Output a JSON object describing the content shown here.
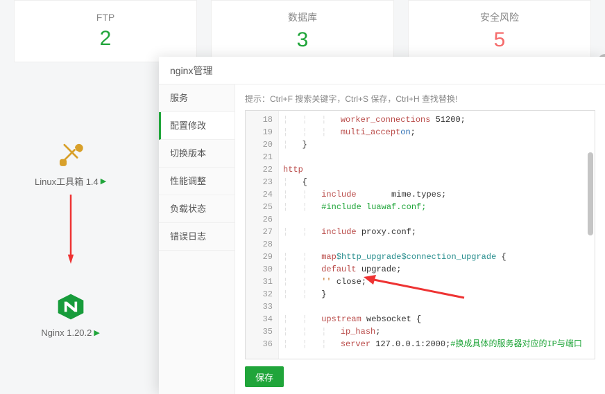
{
  "cards": [
    {
      "label": "FTP",
      "value": "2",
      "color": "green"
    },
    {
      "label": "数据库",
      "value": "3",
      "color": "green"
    },
    {
      "label": "安全风险",
      "value": "5",
      "color": "red"
    }
  ],
  "side_apps": {
    "toolbox_label": "Linux工具箱 1.4",
    "nginx_label": "Nginx 1.20.2"
  },
  "modal": {
    "title": "nginx管理",
    "tabs": [
      "服务",
      "配置修改",
      "切换版本",
      "性能调整",
      "负载状态",
      "错误日志"
    ],
    "active_tab_index": 1,
    "hint": "提示：Ctrl+F 搜索关键字，Ctrl+S 保存，Ctrl+H 查找替换!",
    "save_label": "保存"
  },
  "code_lines": [
    {
      "n": 18,
      "indent": 3,
      "html": "<span class='k-red'>worker_connections</span> 51200;"
    },
    {
      "n": 19,
      "indent": 3,
      "html": "<span class='k-red'>multi_accept</span> <span class='k-blue'>on</span>;"
    },
    {
      "n": 20,
      "indent": 1,
      "html": "}"
    },
    {
      "n": 21,
      "indent": 0,
      "html": ""
    },
    {
      "n": 22,
      "indent": 0,
      "html": "<span class='k-red'>http</span>"
    },
    {
      "n": 23,
      "indent": 1,
      "html": "{"
    },
    {
      "n": 24,
      "indent": 2,
      "html": "<span class='k-red'>include</span>       mime.types;"
    },
    {
      "n": 25,
      "indent": 2,
      "html": "<span class='k-green'>#include luawaf.conf;</span>"
    },
    {
      "n": 26,
      "indent": 0,
      "html": ""
    },
    {
      "n": 27,
      "indent": 2,
      "html": "<span class='k-red'>include</span> proxy.conf;"
    },
    {
      "n": 28,
      "indent": 0,
      "html": ""
    },
    {
      "n": 29,
      "indent": 2,
      "html": "<span class='k-red'>map</span> <span class='k-teal'>$http_upgrade</span> <span class='k-teal'>$connection_upgrade</span> {"
    },
    {
      "n": 30,
      "indent": 2,
      "html": "<span class='k-red'>default</span> upgrade;"
    },
    {
      "n": 31,
      "indent": 2,
      "html": "<span class='k-str'>''</span> close;"
    },
    {
      "n": 32,
      "indent": 2,
      "html": "}"
    },
    {
      "n": 33,
      "indent": 0,
      "html": ""
    },
    {
      "n": 34,
      "indent": 2,
      "html": "<span class='k-red'>upstream</span> websocket {"
    },
    {
      "n": 35,
      "indent": 3,
      "html": "<span class='k-red'>ip_hash</span>;"
    },
    {
      "n": 36,
      "indent": 3,
      "html": "<span class='k-red'>server</span> 127.0.0.1:2000;<span class='k-green'>#换成具体的服务器对应的IP与端口</span>"
    }
  ]
}
